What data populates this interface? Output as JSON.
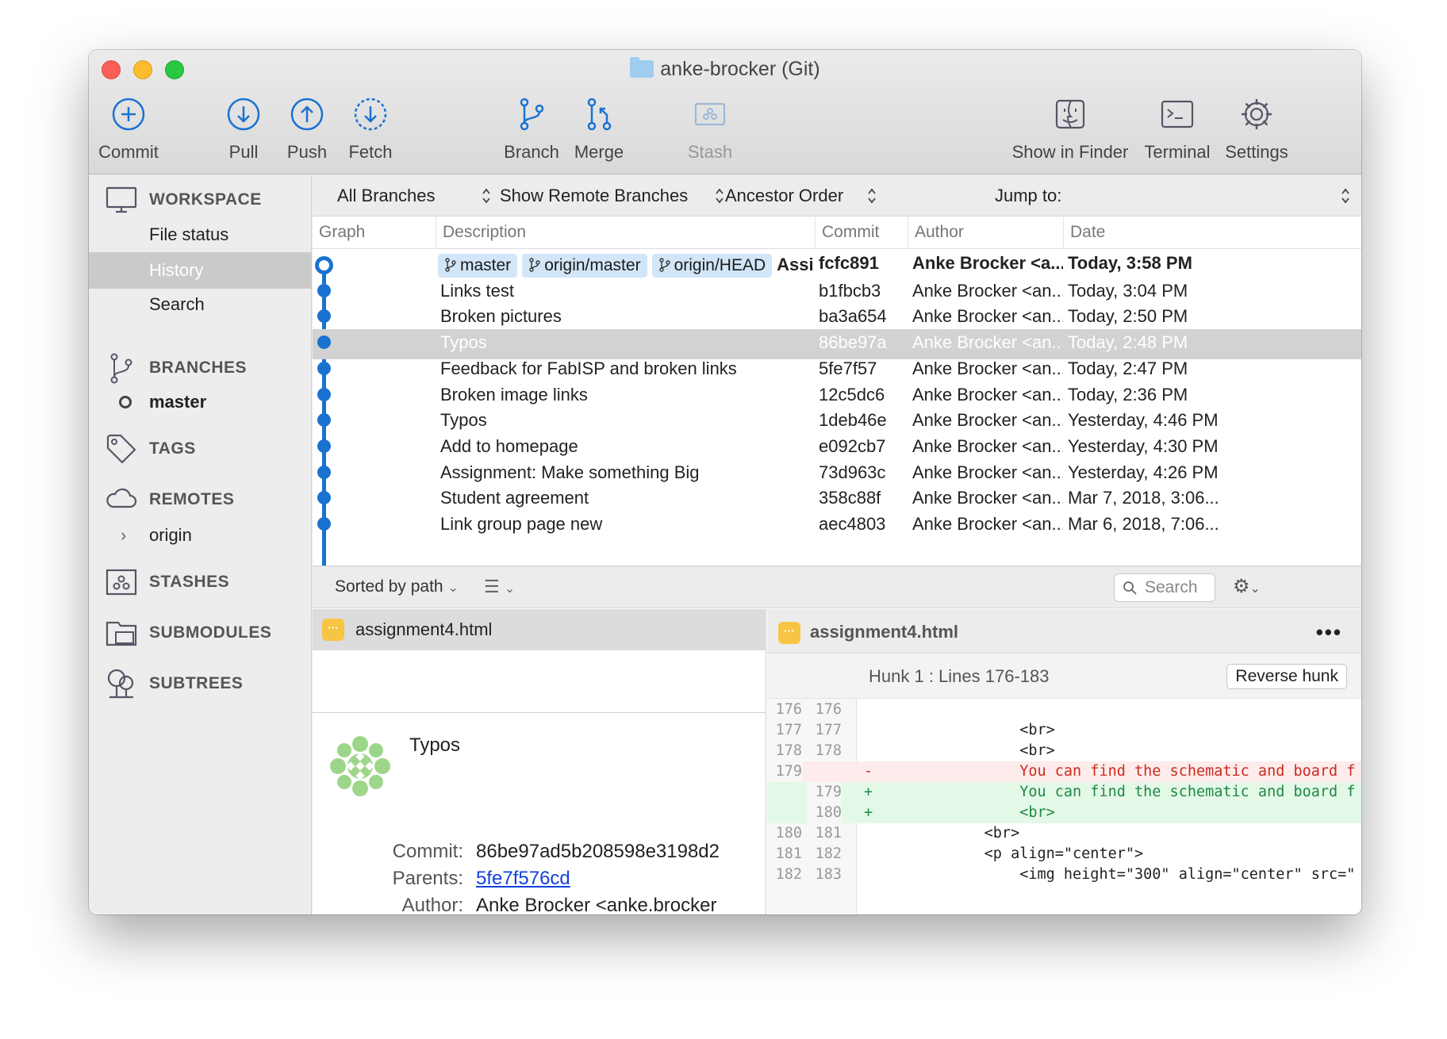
{
  "window": {
    "title": "anke-brocker (Git)"
  },
  "toolbar": {
    "commit": "Commit",
    "pull": "Pull",
    "push": "Push",
    "fetch": "Fetch",
    "branch": "Branch",
    "merge": "Merge",
    "stash": "Stash",
    "show_in_finder": "Show in Finder",
    "terminal": "Terminal",
    "settings": "Settings"
  },
  "sidebar": {
    "workspace": "WORKSPACE",
    "file_status": "File status",
    "history": "History",
    "search": "Search",
    "branches": "BRANCHES",
    "branch_master": "master",
    "tags": "TAGS",
    "remotes": "REMOTES",
    "remote_origin": "origin",
    "stashes": "STASHES",
    "submodules": "SUBMODULES",
    "subtrees": "SUBTREES"
  },
  "filters": {
    "branches": "All Branches",
    "remote": "Show Remote Branches",
    "order": "Ancestor Order",
    "jump_to": "Jump to:"
  },
  "columns": {
    "graph": "Graph",
    "description": "Description",
    "commit": "Commit",
    "author": "Author",
    "date": "Date"
  },
  "head_refs": [
    "master",
    "origin/master",
    "origin/HEAD"
  ],
  "commits": [
    {
      "description": "Assi...",
      "hash": "fcfc891",
      "author": "Anke Brocker <a...",
      "date": "Today, 3:58 PM"
    },
    {
      "description": "Links test",
      "hash": "b1fbcb3",
      "author": "Anke Brocker <an...",
      "date": "Today, 3:04 PM"
    },
    {
      "description": "Broken pictures",
      "hash": "ba3a654",
      "author": "Anke Brocker <an...",
      "date": "Today, 2:50 PM"
    },
    {
      "description": "Typos",
      "hash": "86be97a",
      "author": "Anke Brocker <an...",
      "date": "Today, 2:48 PM"
    },
    {
      "description": "Feedback for FabISP and broken links",
      "hash": "5fe7f57",
      "author": "Anke Brocker <an...",
      "date": "Today, 2:47 PM"
    },
    {
      "description": "Broken image links",
      "hash": "12c5dc6",
      "author": "Anke Brocker <an...",
      "date": "Today, 2:36 PM"
    },
    {
      "description": "Typos",
      "hash": "1deb46e",
      "author": "Anke Brocker <an...",
      "date": "Yesterday, 4:46 PM"
    },
    {
      "description": "Add to homepage",
      "hash": "e092cb7",
      "author": "Anke Brocker <an...",
      "date": "Yesterday, 4:30 PM"
    },
    {
      "description": "Assignment: Make something Big",
      "hash": "73d963c",
      "author": "Anke Brocker <an...",
      "date": "Yesterday, 4:26 PM"
    },
    {
      "description": "Student agreement",
      "hash": "358c88f",
      "author": "Anke Brocker <an...",
      "date": "Mar 7, 2018, 3:06..."
    },
    {
      "description": "Link group page new",
      "hash": "aec4803",
      "author": "Anke Brocker <an...",
      "date": "Mar 6, 2018, 7:06..."
    }
  ],
  "files_bar": {
    "sort": "Sorted by path",
    "search_placeholder": "Search"
  },
  "changed_file": "assignment4.html",
  "commit_detail": {
    "message": "Typos",
    "commit_label": "Commit:",
    "commit_value": "86be97ad5b208598e3198d2",
    "parents_label": "Parents:",
    "parents_value": "5fe7f576cd",
    "author_label": "Author:",
    "author_value": "Anke Brocker <anke.brocker"
  },
  "diff": {
    "file": "assignment4.html",
    "hunk_title": "Hunk 1 : Lines 176-183",
    "reverse_hunk": "Reverse hunk",
    "lines": [
      {
        "old": "176",
        "new": "176",
        "sign": "",
        "code": ""
      },
      {
        "old": "177",
        "new": "177",
        "sign": "",
        "code": "                <br>"
      },
      {
        "old": "178",
        "new": "178",
        "sign": "",
        "code": "                <br>"
      },
      {
        "old": "179",
        "new": "",
        "sign": "-",
        "code": "                You can find the schematic and board f"
      },
      {
        "old": "",
        "new": "179",
        "sign": "+",
        "code": "                You can find the schematic and board f"
      },
      {
        "old": "",
        "new": "180",
        "sign": "+",
        "code": "                <br>"
      },
      {
        "old": "180",
        "new": "181",
        "sign": "",
        "code": "            <br>"
      },
      {
        "old": "181",
        "new": "182",
        "sign": "",
        "code": "            <p align=\"center\">"
      },
      {
        "old": "182",
        "new": "183",
        "sign": "",
        "code": "                <img height=\"300\" align=\"center\" src=\""
      }
    ]
  },
  "colors": {
    "graph": "#1a72d0",
    "ref_pill": "#d2e6f8",
    "file_badge": "#f8c443",
    "deleted": "#cc2a1f",
    "added": "#1d8a43"
  }
}
